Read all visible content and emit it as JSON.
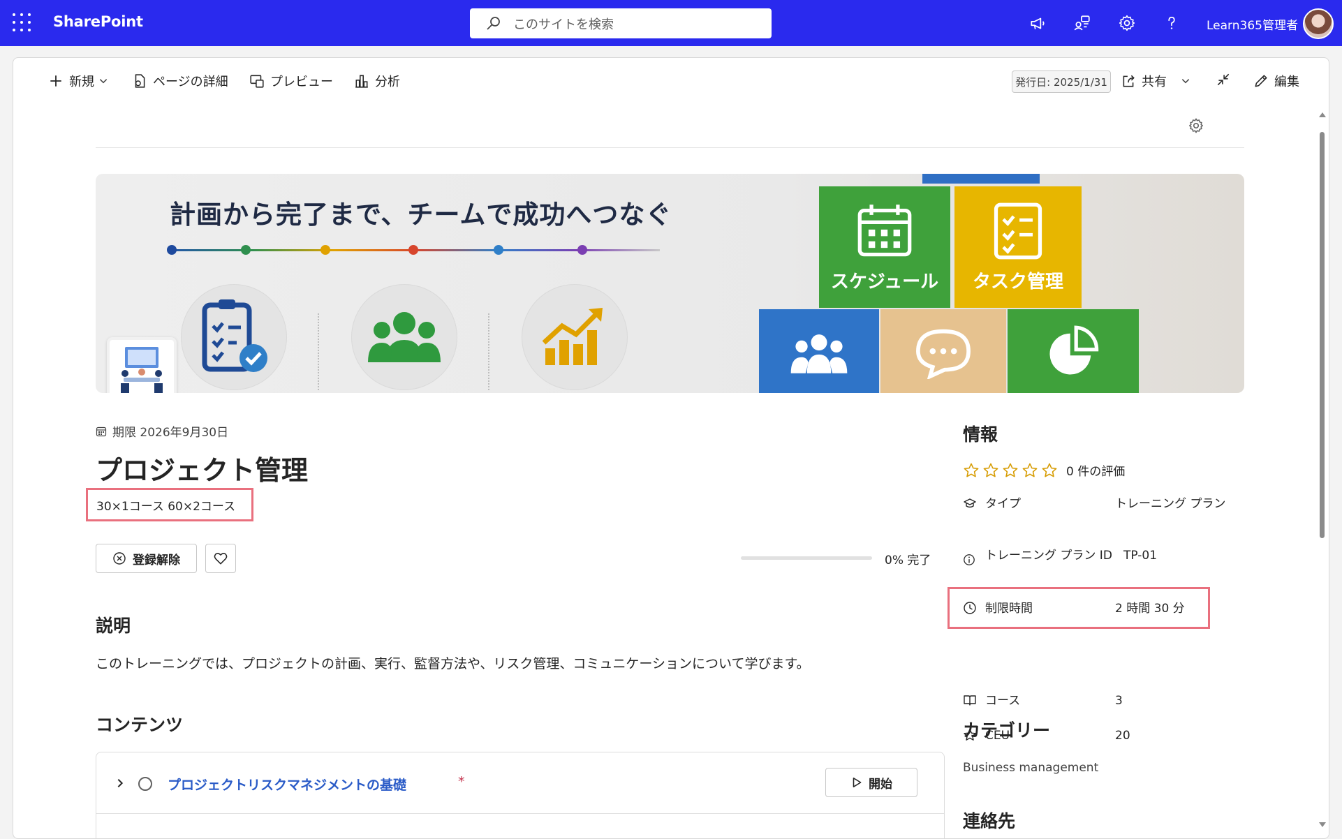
{
  "topbar": {
    "app_name": "SharePoint",
    "search_placeholder": "このサイトを検索",
    "user_name": "Learn365管理者",
    "brand_color": "#2a2aee"
  },
  "command_bar": {
    "new_label": "新規",
    "page_details_label": "ページの詳細",
    "preview_label": "プレビュー",
    "analytics_label": "分析",
    "published_label": "発行日: 2025/1/31",
    "share_label": "共有",
    "edit_label": "編集"
  },
  "banner": {
    "headline": "計画から完了まで、チームで成功へつなぐ",
    "block_schedule": "スケジュール",
    "block_tasks": "タスク管理"
  },
  "plan": {
    "deadline": "期限 2026年9月30日",
    "title": "プロジェクト管理",
    "courses_summary": "30×1コース 60×2コース",
    "unregister_label": "登録解除",
    "progress_percent": 0,
    "progress_label": "0% 完了"
  },
  "description": {
    "heading": "説明",
    "text": "このトレーニングでは、プロジェクトの計画、実行、監督方法や、リスク管理、コミュニケーションについて学びます。"
  },
  "contents": {
    "heading": "コンテンツ",
    "courses": [
      {
        "title": "プロジェクトリスクマネジメントの基礎",
        "required_mark": "*",
        "start_label": "開始"
      }
    ]
  },
  "info": {
    "heading": "情報",
    "rating_count": "0 件の評価",
    "rows": [
      {
        "icon": "type-icon",
        "label": "タイプ",
        "value": "トレーニング プラン"
      },
      {
        "icon": "info-icon",
        "label": "トレーニング プラン ID",
        "value": "TP-01"
      },
      {
        "icon": "clock-icon",
        "label": "制限時間",
        "value": "2 時間 30 分"
      },
      {
        "icon": "book-icon",
        "label": "コース",
        "value": "3"
      },
      {
        "icon": "star-icon",
        "label": "CEU",
        "value": "20"
      }
    ]
  },
  "category": {
    "heading": "カテゴリー",
    "value": "Business management"
  },
  "contact": {
    "heading": "連絡先"
  },
  "highlight_color": "#e9707e"
}
